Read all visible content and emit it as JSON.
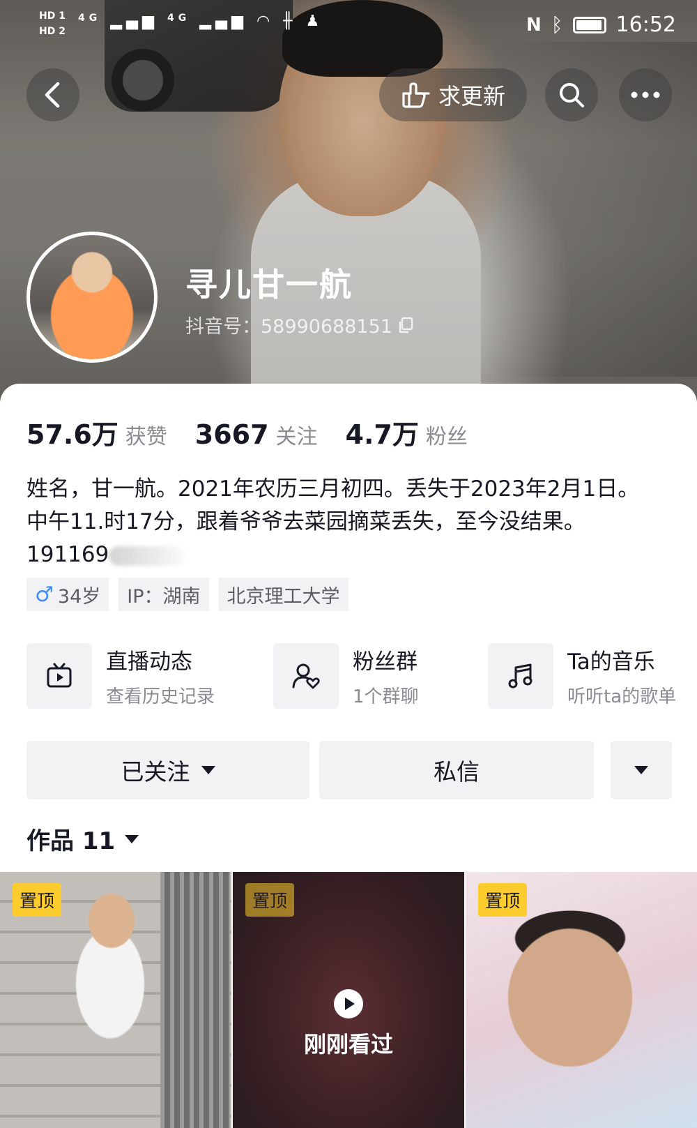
{
  "status_bar": {
    "sim1": "HD 1",
    "sim2": "HD 2",
    "network": "4G",
    "time": "16:52"
  },
  "header": {
    "update_label": "求更新",
    "back_icon": "chevron-left-icon",
    "search_icon": "search-icon",
    "more_icon": "more-dots-icon"
  },
  "profile": {
    "name": "寻儿甘一航",
    "douyin_id": "抖音号：58990688151"
  },
  "stats": [
    {
      "value": "57.6万",
      "label": "获赞"
    },
    {
      "value": "3667",
      "label": "关注"
    },
    {
      "value": "4.7万",
      "label": "粉丝"
    }
  ],
  "bio": {
    "line1": "姓名，甘一航。2021年农历三月初四。丢失于2023年2月1日。",
    "line2": "中午11.时17分，跟着爷爷去菜园摘菜丢失，至今没结果。",
    "line3": "191169"
  },
  "tags": {
    "age": "34岁",
    "ip": "IP：湖南",
    "school": "北京理工大学"
  },
  "features": [
    {
      "title": "直播动态",
      "subtitle": "查看历史记录",
      "icon": "tv-icon"
    },
    {
      "title": "粉丝群",
      "subtitle": "1个群聊",
      "icon": "fan-group-icon"
    },
    {
      "title": "Ta的音乐",
      "subtitle": "听听ta的歌单",
      "icon": "music-note-icon"
    }
  ],
  "actions": {
    "follow_label": "已关注",
    "message_label": "私信"
  },
  "works": {
    "label": "作品 11",
    "items": [
      {
        "pin": "置顶"
      },
      {
        "pin": "置顶",
        "overlay": "刚刚看过"
      },
      {
        "pin": "置顶"
      }
    ]
  },
  "colors": {
    "pin_bg": "#fccb2e",
    "male_icon": "#3f8cff",
    "chip_bg": "#f2f2f4"
  }
}
